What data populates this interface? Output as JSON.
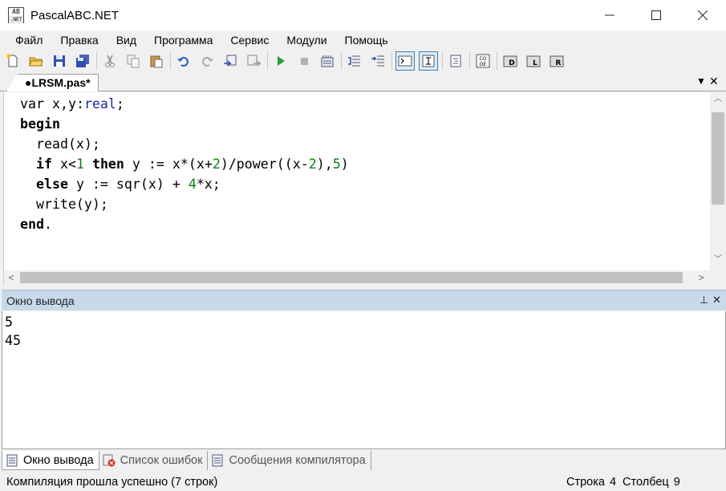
{
  "window": {
    "title": "PascalABC.NET",
    "icon_text_top": "AB",
    "icon_text_bottom": ".NET"
  },
  "menu": [
    "Файл",
    "Правка",
    "Вид",
    "Программа",
    "Сервис",
    "Модули",
    "Помощь"
  ],
  "toolbar": {
    "buttons": [
      "new-file-icon",
      "open-folder-icon",
      "save-icon",
      "save-all-icon",
      "cut-icon",
      "copy-icon",
      "paste-icon",
      "undo-icon",
      "redo-icon",
      "navigate-back-icon",
      "navigate-forward-icon",
      "run-icon",
      "stop-icon",
      "compile-icon",
      "debug-step-icon",
      "debug-step-over-icon",
      "output-console-icon",
      "text-cursor-icon",
      "format-code-icon",
      "code-template-icon",
      "help-d-icon",
      "help-l-icon",
      "help-r-icon"
    ]
  },
  "editor": {
    "tab_label": "●LRSM.pas*",
    "lines": [
      [
        {
          "t": "var",
          "c": "kw0"
        },
        {
          "t": " x,y:"
        },
        {
          "t": "real",
          "c": "ty"
        },
        {
          "t": ";"
        }
      ],
      [
        {
          "t": "begin",
          "c": "kw"
        }
      ],
      [
        {
          "t": "  read(x);"
        }
      ],
      [
        {
          "t": "  "
        },
        {
          "t": "if",
          "c": "kw"
        },
        {
          "t": " x<"
        },
        {
          "t": "1",
          "c": "num"
        },
        {
          "t": " "
        },
        {
          "t": "then",
          "c": "kw"
        },
        {
          "t": " y := x*(x+"
        },
        {
          "t": "2",
          "c": "num"
        },
        {
          "t": ")/power((x-"
        },
        {
          "t": "2",
          "c": "num"
        },
        {
          "t": "),"
        },
        {
          "t": "5",
          "c": "num"
        },
        {
          "t": ")"
        }
      ],
      [
        {
          "t": "  "
        },
        {
          "t": "else",
          "c": "kw"
        },
        {
          "t": " y := sqr(x) + "
        },
        {
          "t": "4",
          "c": "num"
        },
        {
          "t": "*x;"
        }
      ],
      [
        {
          "t": "  write(y);"
        }
      ],
      [
        {
          "t": "end",
          "c": "kw"
        },
        {
          "t": "."
        }
      ]
    ]
  },
  "output_panel": {
    "title": "Окно вывода",
    "lines": [
      "5",
      "45"
    ]
  },
  "bottom_tabs": [
    {
      "label": "Окно вывода",
      "icon": "output-window-icon",
      "active": true
    },
    {
      "label": "Список ошибок",
      "icon": "error-list-icon",
      "active": false
    },
    {
      "label": "Сообщения компилятора",
      "icon": "compiler-messages-icon",
      "active": false
    }
  ],
  "status": {
    "message": "Компиляция прошла успешно (7 строк)",
    "row_label": "Строка",
    "row_value": "4",
    "col_label": "Столбец",
    "col_value": "9"
  }
}
